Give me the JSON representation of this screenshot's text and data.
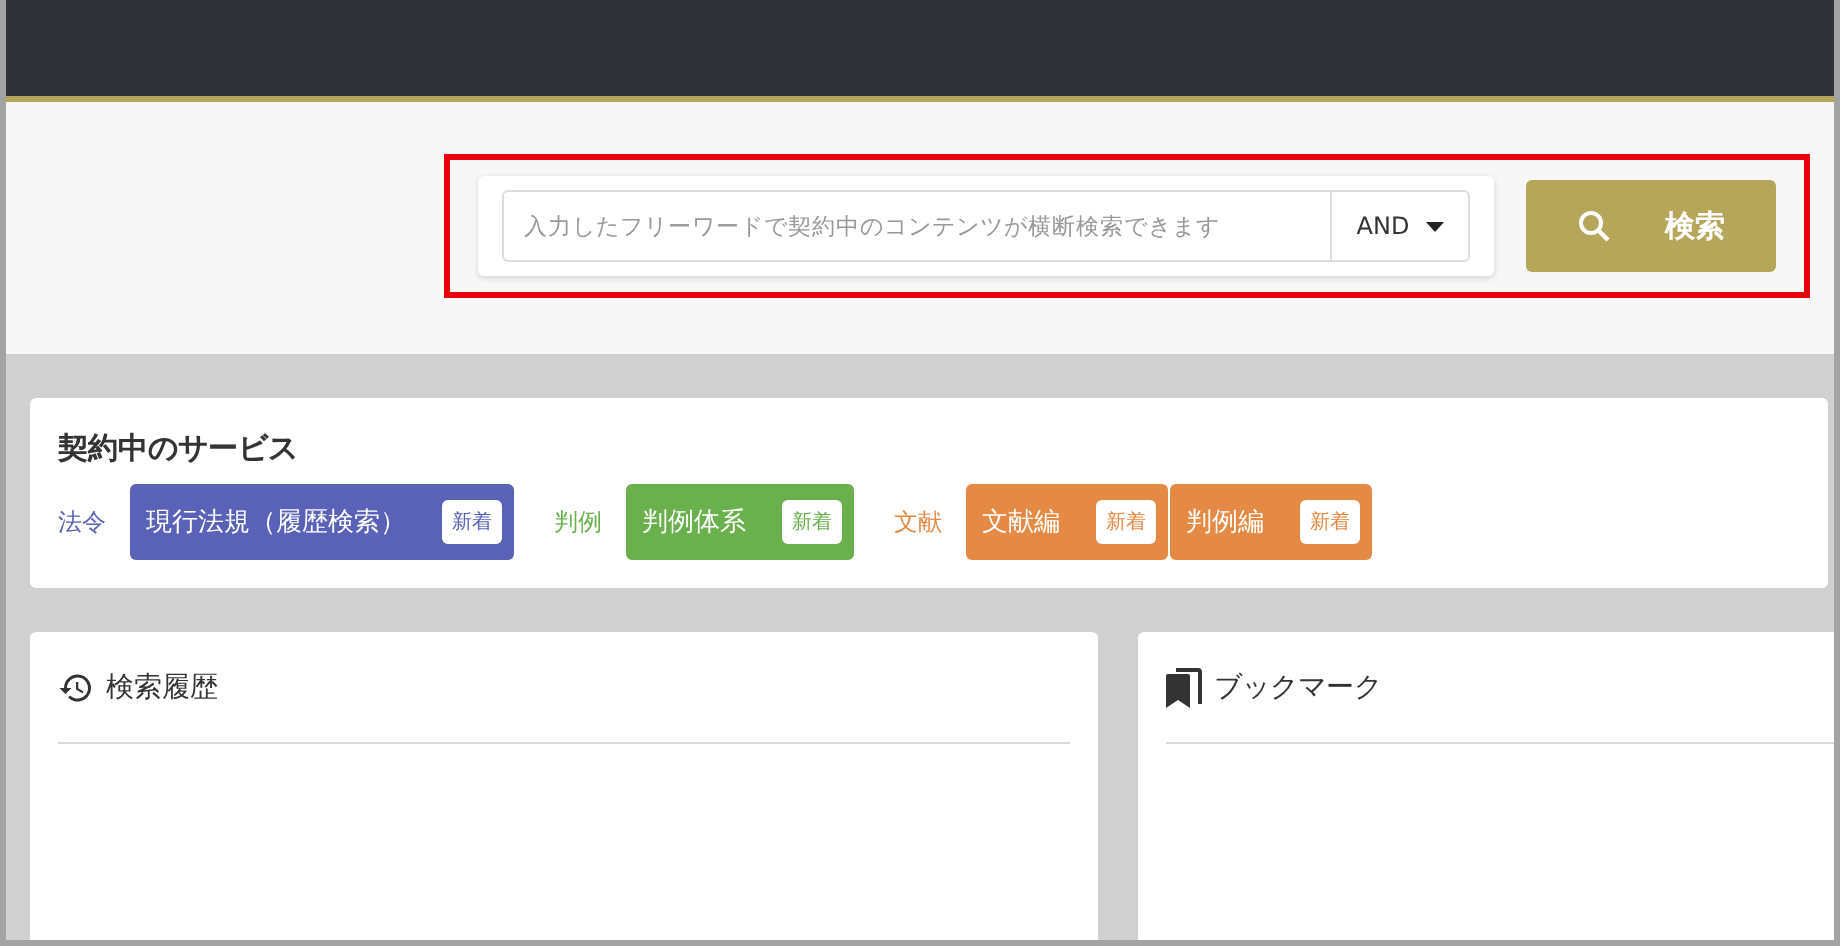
{
  "search": {
    "placeholder": "入力したフリーワードで契約中のコンテンツが横断検索できます",
    "mode": "AND",
    "button": "検索"
  },
  "services": {
    "title": "契約中のサービス",
    "groups": [
      {
        "label": "法令",
        "color": "#5a62b8",
        "items": [
          {
            "name": "現行法規（履歴検索）",
            "badge": "新着"
          }
        ]
      },
      {
        "label": "判例",
        "color": "#6ab04c",
        "items": [
          {
            "name": "判例体系",
            "badge": "新着"
          }
        ]
      },
      {
        "label": "文献",
        "color": "#e58a45",
        "items": [
          {
            "name": "文献編",
            "badge": "新着"
          },
          {
            "name": "判例編",
            "badge": "新着"
          }
        ]
      }
    ]
  },
  "panels": [
    {
      "kind": "history",
      "title": "検索履歴"
    },
    {
      "kind": "bookmark",
      "title": "ブックマーク"
    }
  ]
}
